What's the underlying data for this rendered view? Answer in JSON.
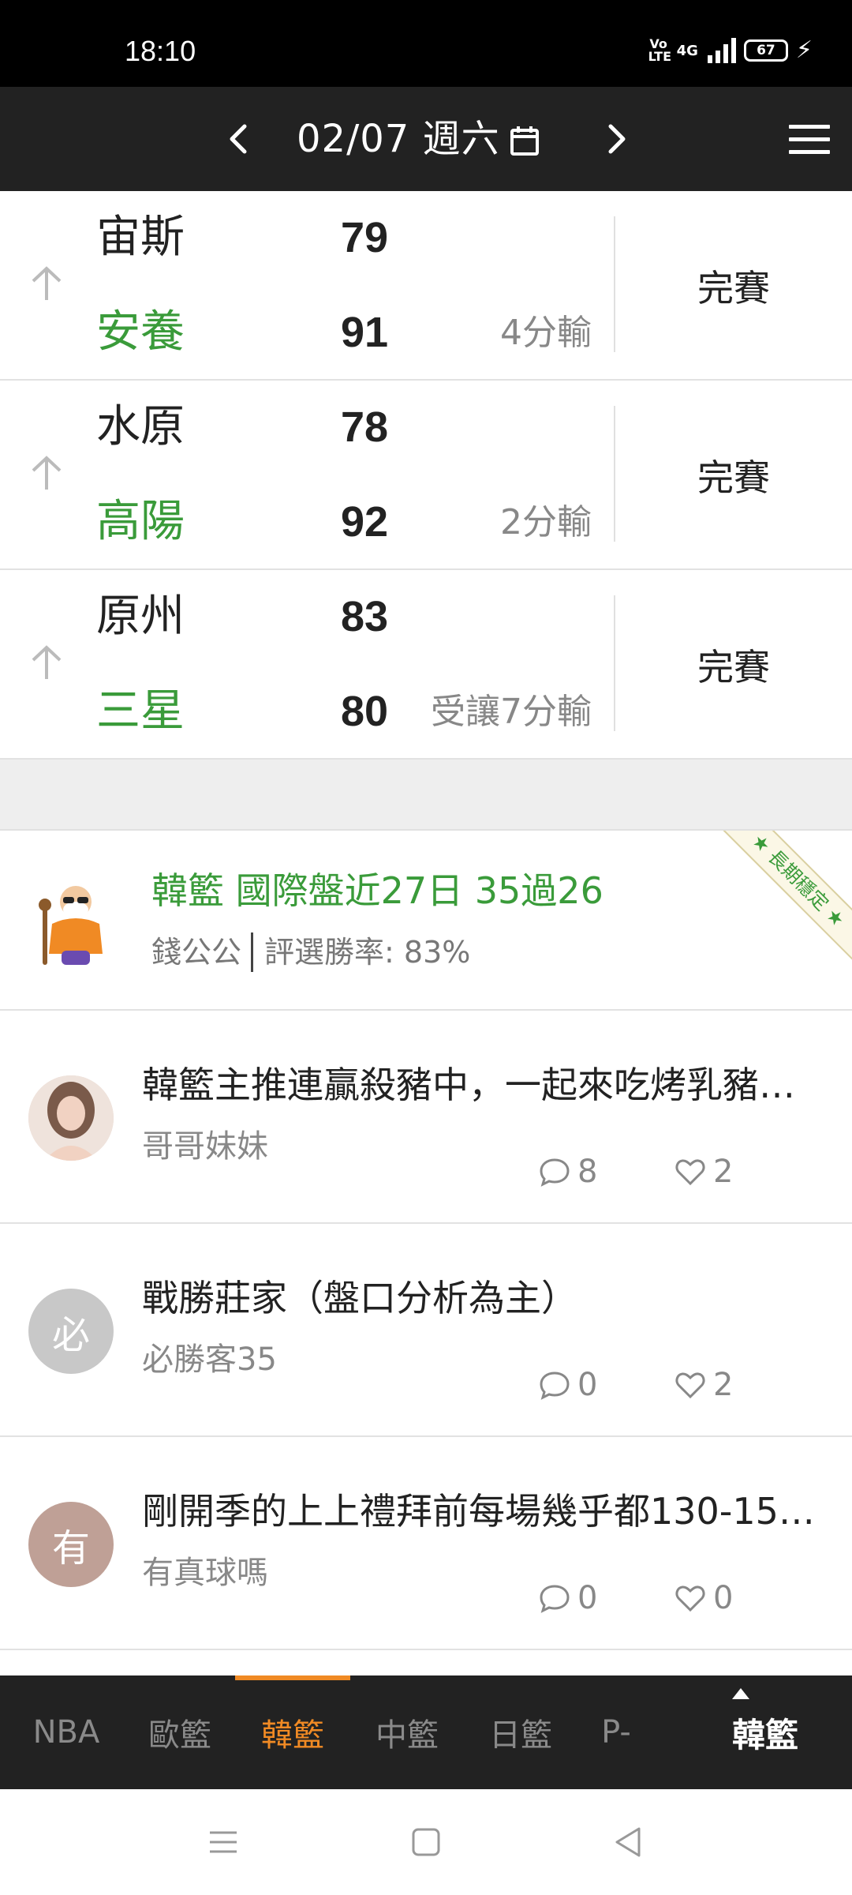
{
  "status_bar": {
    "time": "18:10",
    "volte": "Vo\nLTE",
    "network": "4G",
    "battery": "67"
  },
  "header": {
    "date": "02/07 週六",
    "prev_icon": "chevron-left-icon",
    "next_icon": "chevron-right-icon",
    "calendar_icon": "calendar-icon",
    "menu_icon": "menu-icon"
  },
  "games": [
    {
      "away_team": "宙斯",
      "away_score": "79",
      "home_team": "安養",
      "home_score": "91",
      "result": "4分輸",
      "status": "完賽"
    },
    {
      "away_team": "水原",
      "away_score": "78",
      "home_team": "高陽",
      "home_score": "92",
      "result": "2分輸",
      "status": "完賽"
    },
    {
      "away_team": "原州",
      "away_score": "83",
      "home_team": "三星",
      "home_score": "80",
      "result": "受讓7分輸",
      "status": "完賽"
    }
  ],
  "promo": {
    "title": "韓籃 國際盤近27日 35過26",
    "author": "錢公公",
    "win_rate": "評選勝率: 83%",
    "ribbon": "★ 長期穩定 ★"
  },
  "posts": [
    {
      "title": "韓籃主推連贏殺豬中，一起來吃烤乳豬…",
      "author": "哥哥妹妹",
      "comments": "8",
      "likes": "2",
      "avatar_letter": "",
      "avatar_color": "#d9c3b8"
    },
    {
      "title": "戰勝莊家（盤口分析為主）",
      "author": "必勝客35",
      "comments": "0",
      "likes": "2",
      "avatar_letter": "必",
      "avatar_color": "#c8c8c8"
    },
    {
      "title": "剛開季的上上禮拜前每場幾乎都130-15…",
      "author": "有真球嗎",
      "comments": "0",
      "likes": "0",
      "avatar_letter": "有",
      "avatar_color": "#bfa096"
    }
  ],
  "tabs": [
    {
      "label": "NBA"
    },
    {
      "label": "歐籃"
    },
    {
      "label": "韓籃"
    },
    {
      "label": "中籃"
    },
    {
      "label": "日籃"
    },
    {
      "label": "P-"
    }
  ],
  "tab_current": "韓籃",
  "colors": {
    "accent": "#f08a24",
    "home_team": "#3a9b3a",
    "header_bg": "#222222"
  }
}
